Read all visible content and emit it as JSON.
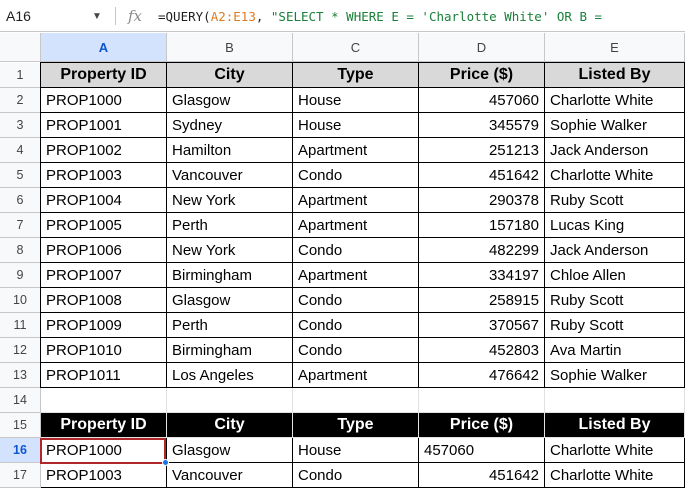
{
  "name_box": {
    "value": "A16"
  },
  "formula_bar": {
    "fx_label": "fx",
    "prefix": "=QUERY(",
    "range": "A2:E13",
    "middle": ", ",
    "string": "\"SELECT * WHERE E = 'Charlotte White' OR B = "
  },
  "columns": [
    "A",
    "B",
    "C",
    "D",
    "E"
  ],
  "selected_column": "A",
  "rows": [
    "1",
    "2",
    "3",
    "4",
    "5",
    "6",
    "7",
    "8",
    "9",
    "10",
    "11",
    "12",
    "13",
    "14",
    "15",
    "16",
    "17"
  ],
  "selected_row": "16",
  "active_cell": "A16",
  "table_header": [
    "Property ID",
    "City",
    "Type",
    "Price ($)",
    "Listed By"
  ],
  "table_rows": [
    [
      "PROP1000",
      "Glasgow",
      "House",
      "457060",
      "Charlotte White"
    ],
    [
      "PROP1001",
      "Sydney",
      "House",
      "345579",
      "Sophie Walker"
    ],
    [
      "PROP1002",
      "Hamilton",
      "Apartment",
      "251213",
      "Jack Anderson"
    ],
    [
      "PROP1003",
      "Vancouver",
      "Condo",
      "451642",
      "Charlotte White"
    ],
    [
      "PROP1004",
      "New York",
      "Apartment",
      "290378",
      "Ruby Scott"
    ],
    [
      "PROP1005",
      "Perth",
      "Apartment",
      "157180",
      "Lucas King"
    ],
    [
      "PROP1006",
      "New York",
      "Condo",
      "482299",
      "Jack Anderson"
    ],
    [
      "PROP1007",
      "Birmingham",
      "Apartment",
      "334197",
      "Chloe Allen"
    ],
    [
      "PROP1008",
      "Glasgow",
      "Condo",
      "258915",
      "Ruby Scott"
    ],
    [
      "PROP1009",
      "Perth",
      "Condo",
      "370567",
      "Ruby Scott"
    ],
    [
      "PROP1010",
      "Birmingham",
      "Condo",
      "452803",
      "Ava Martin"
    ],
    [
      "PROP1011",
      "Los Angeles",
      "Apartment",
      "476642",
      "Sophie Walker"
    ]
  ],
  "query_header": [
    "Property ID",
    "City",
    "Type",
    "Price ($)",
    "Listed By"
  ],
  "query_rows": [
    [
      "PROP1000",
      "Glasgow",
      "House",
      "457060",
      "Charlotte White"
    ],
    [
      "PROP1003",
      "Vancouver",
      "Condo",
      "451642",
      "Charlotte White"
    ]
  ],
  "query_price_left_aligned_rows": [
    0
  ],
  "colors": {
    "header_gray": "#d9d9d9",
    "header_black": "#000000",
    "selection_blue": "#d3e3fd",
    "active_cell_border": "#b0272b",
    "formula_range": "#e07b20",
    "formula_string": "#188038"
  }
}
